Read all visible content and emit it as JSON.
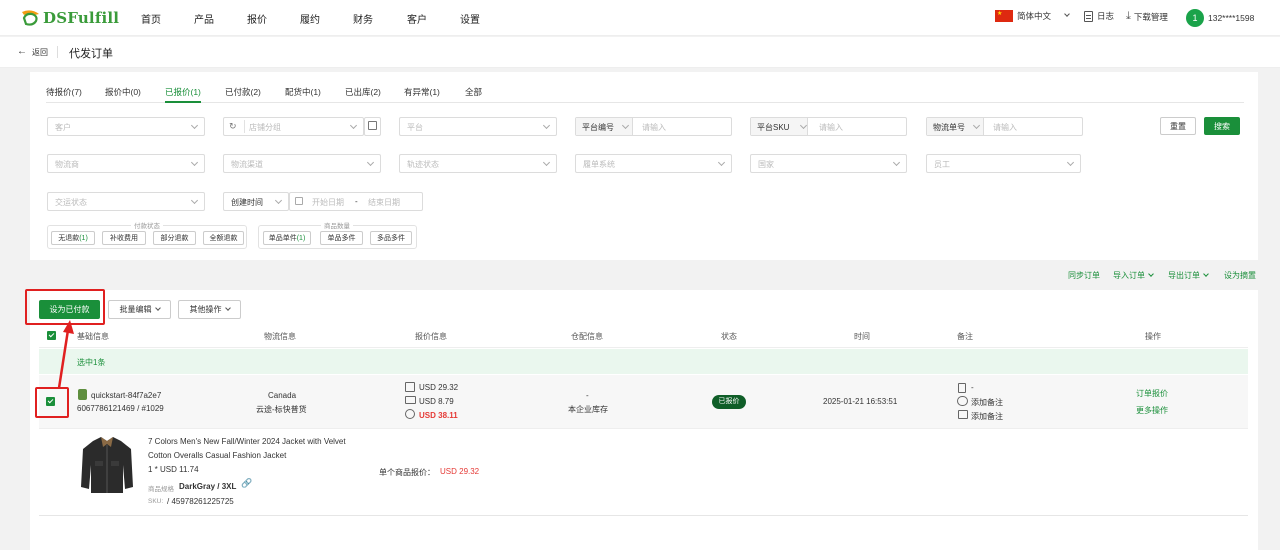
{
  "app": {
    "logo_text": "DSFulfill",
    "menu": [
      "首页",
      "产品",
      "报价",
      "履约",
      "财务",
      "客户",
      "设置"
    ],
    "language": "简体中文",
    "log_label": "日志",
    "download_label": "下载管理",
    "user_avatar_letter": "1",
    "user_name": "132****1598"
  },
  "header": {
    "back_label": "返回",
    "page_title": "代发订单"
  },
  "tabs": [
    {
      "label": "待报价(7)",
      "active": false
    },
    {
      "label": "报价中(0)",
      "active": false
    },
    {
      "label": "已报价(1)",
      "active": true
    },
    {
      "label": "已付款(2)",
      "active": false
    },
    {
      "label": "配货中(1)",
      "active": false
    },
    {
      "label": "已出库(2)",
      "active": false
    },
    {
      "label": "有异常(1)",
      "active": false
    },
    {
      "label": "全部",
      "active": false
    }
  ],
  "filters": {
    "customer": "客户",
    "store_group": "店铺分组",
    "platform": "平台",
    "platform_no_prefix": "平台编号",
    "platform_no_ph": "请输入",
    "platform_sku_prefix": "平台SKU",
    "platform_sku_ph": "请输入",
    "tracking_prefix": "物流单号",
    "tracking_ph": "请输入",
    "reset": "重置",
    "search": "搜索",
    "carrier": "物流商",
    "channel": "物流渠道",
    "track_status": "轨迹状态",
    "fulfill_system": "履单系统",
    "country": "国家",
    "staff": "员工",
    "deal_status": "交运状态",
    "time_type": "创建时间",
    "start_date": "开始日期",
    "date_sep": "-",
    "end_date": "结束日期",
    "refund_group_title": "付款状态",
    "refund_chips": [
      {
        "label": "无退款",
        "count": "(1)"
      },
      {
        "label": "补收费用",
        "count": ""
      },
      {
        "label": "部分退款",
        "count": ""
      },
      {
        "label": "全额退款",
        "count": ""
      }
    ],
    "qty_group_title": "商品数量",
    "qty_chips": [
      {
        "label": "单品单件",
        "count": "(1)"
      },
      {
        "label": "单品多件",
        "count": ""
      },
      {
        "label": "多品多件",
        "count": ""
      }
    ]
  },
  "actions": {
    "sync": "同步订单",
    "import": "导入订单",
    "export": "导出订单",
    "set_summary": "设为摘置",
    "set_paid": "设为已付款",
    "batch_edit": "批量编辑",
    "other_ops": "其他操作"
  },
  "table": {
    "columns": [
      "基础信息",
      "物流信息",
      "报价信息",
      "仓配信息",
      "状态",
      "时间",
      "备注",
      "操作"
    ],
    "selected_text": "选中1条",
    "row": {
      "store": "quickstart-84f7a2e7",
      "order_no": "6067786121469 / #1029",
      "country": "Canada",
      "channel": "云途-标快普货",
      "product_price": "USD 29.32",
      "shipping_price": "USD 8.79",
      "total_price": "USD 38.11",
      "warehouse": "-",
      "warehouse_note": "本企业库存",
      "status": "已报价",
      "time": "2025-01-21 16:53:51",
      "remark1": "-",
      "remark2": "添加备注",
      "remark3": "添加备注",
      "op_quote": "订单报价",
      "op_more": "更多操作"
    },
    "product": {
      "title_line1": "7 Colors Men's New Fall/Winter 2024 Jacket with Velvet",
      "title_line2": "Cotton Overalls Casual Fashion Jacket",
      "qty_price": "1 * USD 11.74",
      "spec_label": "商品规格",
      "spec_value": "DarkGray / 3XL",
      "sku_label": "SKU:",
      "sku_value": "/ 45978261225725",
      "unit_quote_label": "单个商品报价：",
      "unit_quote_value": "USD 29.32"
    }
  },
  "colors": {
    "brand_green": "#1a8f3a",
    "highlight_red": "#e02020"
  }
}
